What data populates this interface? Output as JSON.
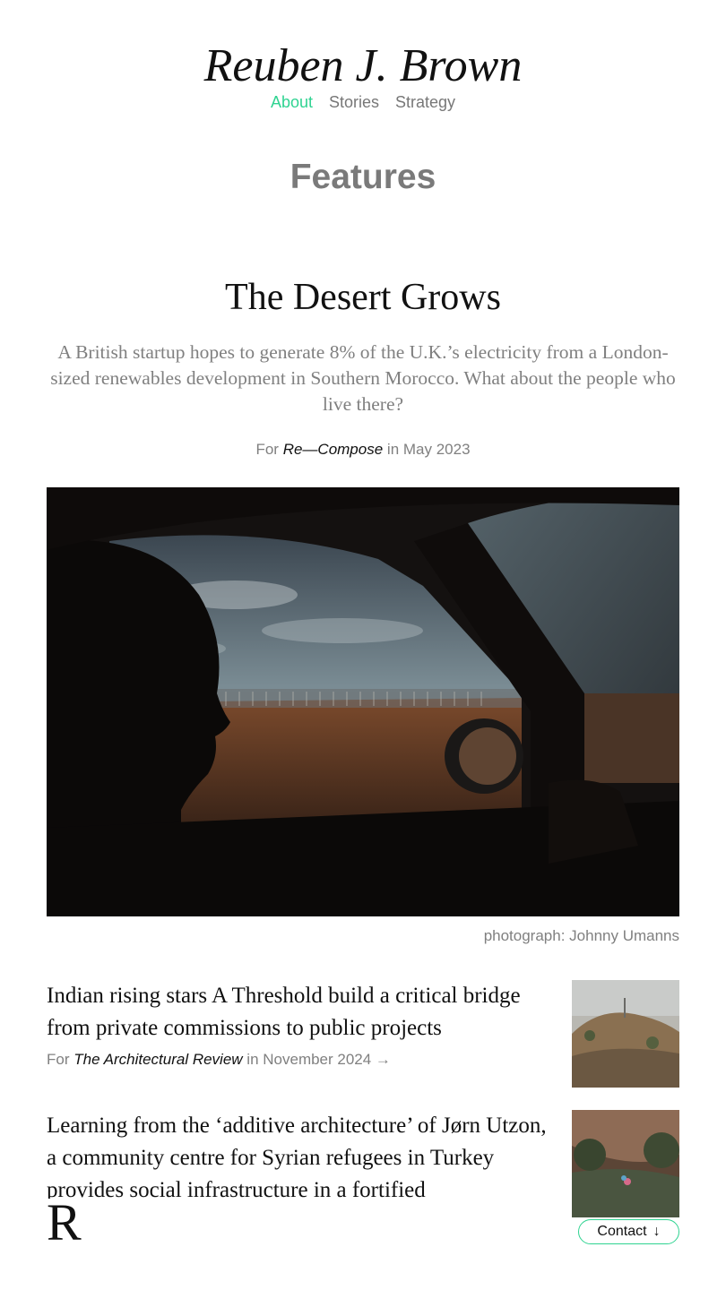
{
  "header": {
    "site_title": "Reuben J. Brown",
    "nav": [
      {
        "label": "About",
        "active": true
      },
      {
        "label": "Stories",
        "active": false
      },
      {
        "label": "Strategy",
        "active": false
      }
    ]
  },
  "section": {
    "heading": "Features"
  },
  "feature": {
    "title": "The Desert Grows",
    "dek": "A British startup hopes to generate 8% of the U.K.’s electricity from a London-sized renewables development in Southern Morocco. What about the people who live there?",
    "byline_prefix": "For",
    "publication": "Re—Compose",
    "byline_suffix": "in May 2023",
    "photo_credit": "photograph: Johnny Umanns"
  },
  "stories": [
    {
      "headline": "Indian rising stars A Threshold build a critical bridge from private commissions to public projects",
      "prefix": "For",
      "publication": "The Architectural Review",
      "suffix": "in November 2024 →"
    },
    {
      "headline": "Learning from the ‘additive architecture’ of Jørn Utzon, a community centre for Syrian refugees in Turkey provides social infrastructure in a fortified"
    }
  ],
  "footer": {
    "logo_letter": "R",
    "contact_label": "Contact",
    "contact_arrow": "↓"
  },
  "colors": {
    "accent": "#2fd391",
    "muted_text": "#808080",
    "body_text": "#111111"
  },
  "icons": {
    "contact": "arrow-down-icon"
  }
}
